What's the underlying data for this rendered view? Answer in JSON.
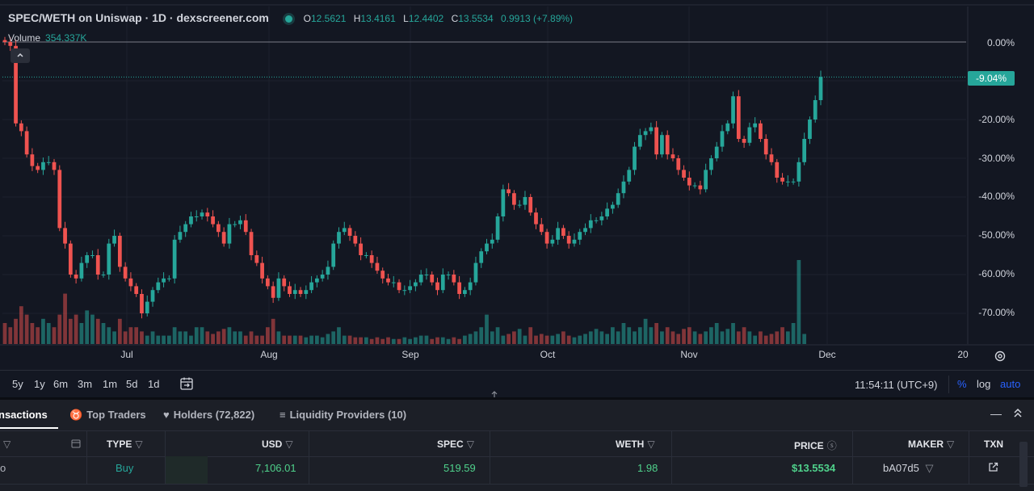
{
  "header": {
    "title": "SPEC/WETH on Uniswap · 1D · dexscreener.com",
    "ohlc": {
      "o_label": "O",
      "o": "12.5621",
      "h_label": "H",
      "h": "13.4161",
      "l_label": "L",
      "l": "12.4402",
      "c_label": "C",
      "c": "13.5534",
      "change": "0.9913 (+7.89%)"
    },
    "volume_label": "Volume",
    "volume_value": "354.337K",
    "collapse_icon": "chevron-up-icon"
  },
  "colors": {
    "up": "#26a69a",
    "down": "#ef5350",
    "accent": "#2962ff",
    "background": "#131722"
  },
  "chart_data": {
    "type": "candlestick",
    "y_scale": "percent",
    "y_ticks": [
      "0.00%",
      "-20.00%",
      "-30.00%",
      "-40.00%",
      "-50.00%",
      "-60.00%",
      "-70.00%"
    ],
    "ylim": [
      -78,
      2
    ],
    "x_ticks": [
      "Jul",
      "Aug",
      "Sep",
      "Oct",
      "Nov",
      "Dec",
      "20"
    ],
    "current_label": "-9.04%",
    "grid": true,
    "series": [
      {
        "name": "price_pct_close",
        "values": [
          0,
          -1,
          -21,
          -23,
          -29,
          -32,
          -33,
          -31,
          -31,
          -33,
          -48,
          -52,
          -60,
          -61,
          -57,
          -55,
          -55,
          -60,
          -60,
          -52,
          -50,
          -58,
          -61,
          -63,
          -65,
          -70,
          -67,
          -64,
          -62,
          -61,
          -61,
          -51,
          -49,
          -47,
          -45,
          -45,
          -44,
          -45,
          -47,
          -49,
          -52,
          -47,
          -47,
          -46,
          -49,
          -55,
          -57,
          -61,
          -63,
          -66,
          -61,
          -63,
          -65,
          -64,
          -65,
          -64,
          -62,
          -61,
          -60,
          -58,
          -52,
          -49,
          -48,
          -50,
          -52,
          -55,
          -55,
          -57,
          -59,
          -61,
          -62,
          -62,
          -64,
          -64,
          -63,
          -62,
          -60,
          -60,
          -62,
          -64,
          -60,
          -60,
          -62,
          -65,
          -64,
          -62,
          -57,
          -54,
          -52,
          -51,
          -45,
          -38,
          -39,
          -42,
          -42,
          -40,
          -44,
          -47,
          -49,
          -52,
          -51,
          -48,
          -50,
          -52,
          -51,
          -49,
          -48,
          -46,
          -46,
          -45,
          -43,
          -42,
          -39,
          -36,
          -33,
          -27,
          -24,
          -23,
          -22,
          -29,
          -24,
          -29,
          -30,
          -33,
          -35,
          -37,
          -37,
          -38,
          -33,
          -30,
          -27,
          -23,
          -21,
          -14,
          -25,
          -26,
          -22,
          -21,
          -25,
          -29,
          -31,
          -35,
          -36,
          -36,
          -36,
          -31,
          -25,
          -20,
          -15,
          -9
        ]
      },
      {
        "name": "volume_rel",
        "values": [
          0.25,
          0.2,
          0.3,
          0.45,
          0.35,
          0.25,
          0.2,
          0.3,
          0.25,
          0.2,
          0.35,
          0.6,
          0.3,
          0.35,
          0.25,
          0.4,
          0.35,
          0.3,
          0.25,
          0.2,
          0.15,
          0.3,
          0.15,
          0.2,
          0.2,
          0.15,
          0.1,
          0.15,
          0.1,
          0.1,
          0.1,
          0.2,
          0.15,
          0.15,
          0.1,
          0.2,
          0.2,
          0.15,
          0.12,
          0.15,
          0.18,
          0.2,
          0.15,
          0.15,
          0.1,
          0.15,
          0.1,
          0.1,
          0.2,
          0.3,
          0.15,
          0.1,
          0.1,
          0.1,
          0.1,
          0.08,
          0.1,
          0.1,
          0.08,
          0.12,
          0.15,
          0.2,
          0.1,
          0.1,
          0.08,
          0.08,
          0.08,
          0.06,
          0.08,
          0.06,
          0.08,
          0.06,
          0.06,
          0.08,
          0.06,
          0.08,
          0.1,
          0.1,
          0.06,
          0.08,
          0.08,
          0.06,
          0.08,
          0.06,
          0.1,
          0.12,
          0.15,
          0.2,
          0.35,
          0.15,
          0.2,
          0.1,
          0.12,
          0.15,
          0.18,
          0.1,
          0.2,
          0.1,
          0.12,
          0.1,
          0.1,
          0.12,
          0.15,
          0.1,
          0.08,
          0.1,
          0.12,
          0.15,
          0.18,
          0.15,
          0.12,
          0.2,
          0.15,
          0.25,
          0.2,
          0.15,
          0.2,
          0.3,
          0.2,
          0.25,
          0.15,
          0.2,
          0.15,
          0.12,
          0.18,
          0.2,
          0.15,
          0.12,
          0.15,
          0.2,
          0.25,
          0.15,
          0.18,
          0.25,
          0.15,
          0.2,
          0.15,
          0.1,
          0.15,
          0.1,
          0.12,
          0.15,
          0.2,
          0.15,
          0.25,
          1.0,
          0.12
        ]
      }
    ]
  },
  "toolbar": {
    "ranges": [
      "5y",
      "1y",
      "6m",
      "3m",
      "1m",
      "5d",
      "1d"
    ],
    "calendar_icon": "calendar-icon",
    "clock": "11:54:11 (UTC+9)",
    "percent": "%",
    "log": "log",
    "auto": "auto"
  },
  "panel": {
    "tabs": {
      "transactions": "nsactions",
      "top_traders": "Top Traders",
      "holders": "Holders (72,822)",
      "liquidity": "Liquidity Providers (10)"
    },
    "minimize": "—",
    "expand": "⌃"
  },
  "table": {
    "headers": {
      "type": "TYPE",
      "usd": "USD",
      "spec": "SPEC",
      "weth": "WETH",
      "price": "PRICE",
      "maker": "MAKER",
      "txn": "TXN"
    },
    "rows": [
      {
        "lead": "o",
        "type": "Buy",
        "usd": "7,106.01",
        "spec": "519.59",
        "weth": "1.98",
        "price": "$13.5534",
        "maker": "bA07d5"
      }
    ]
  }
}
